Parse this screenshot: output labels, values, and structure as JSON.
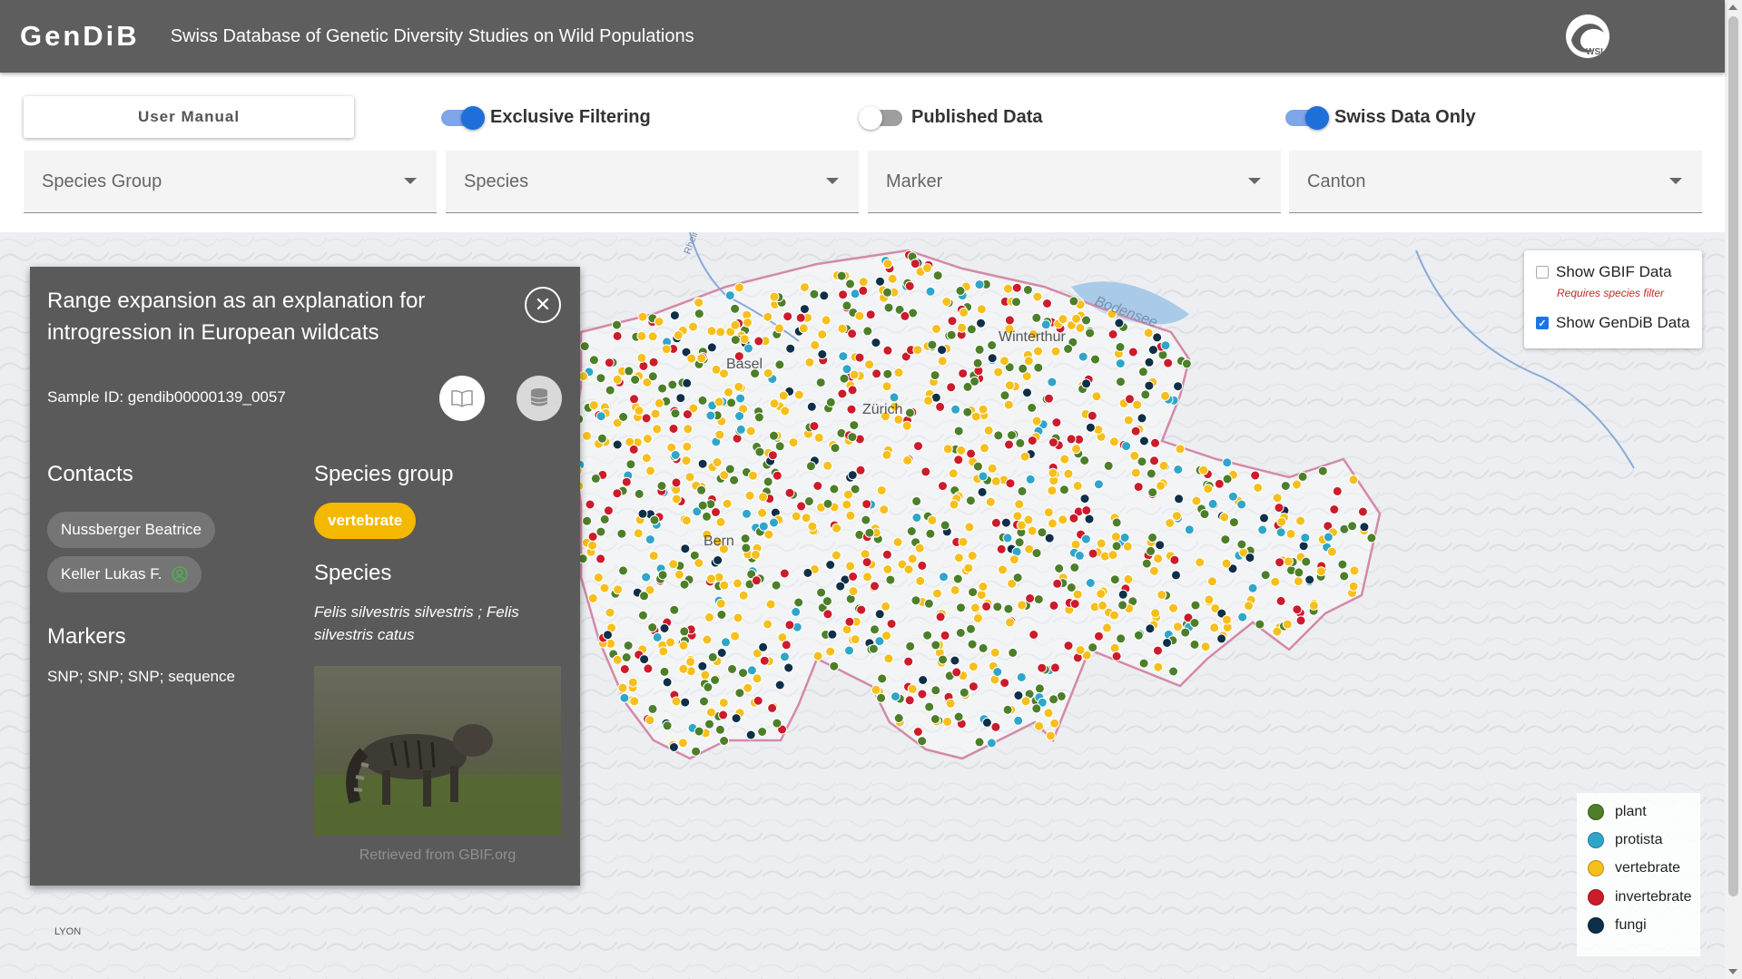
{
  "header": {
    "logo": "GenDiB",
    "title": "Swiss Database of Genetic Diversity Studies on Wild Populations",
    "org_logo_text": "WSL"
  },
  "controls": {
    "manual_label": "User Manual",
    "toggles": [
      {
        "label": "Exclusive Filtering",
        "on": true
      },
      {
        "label": "Published Data",
        "on": false
      },
      {
        "label": "Swiss Data Only",
        "on": true
      }
    ],
    "selects": [
      {
        "placeholder": "Species Group"
      },
      {
        "placeholder": "Species"
      },
      {
        "placeholder": "Marker"
      },
      {
        "placeholder": "Canton"
      }
    ]
  },
  "map": {
    "labels": [
      "Basel",
      "Zürich",
      "Bern",
      "Winterthur",
      "Bodensee",
      "LYON",
      "Rhein"
    ],
    "marker_colors": {
      "plant": "#4d7f2a",
      "protista": "#2fa6c9",
      "vertebrate": "#f6bf1c",
      "invertebrate": "#cc1b2b",
      "fungi": "#0e2f47"
    }
  },
  "popup": {
    "title": "Range expansion as an explanation for introgression in European wildcats",
    "sample_id": "Sample ID: gendib00000139_0057",
    "contacts_heading": "Contacts",
    "contacts": [
      "Nussberger Beatrice",
      "Keller Lukas F."
    ],
    "species_group_heading": "Species group",
    "species_group": "vertebrate",
    "species_heading": "Species",
    "species": "Felis silvestris silvestris ; Felis silvestris catus",
    "markers_heading": "Markers",
    "markers": "SNP; SNP; SNP; sequence",
    "image_credit": "Retrieved from GBIF.org"
  },
  "layers": {
    "gbif_label": "Show GBIF Data",
    "gbif_checked": false,
    "gbif_note": "Requires species filter",
    "gendib_label": "Show GenDiB Data",
    "gendib_checked": true
  },
  "legend": [
    {
      "label": "plant",
      "color": "#4d7f2a"
    },
    {
      "label": "protista",
      "color": "#2fa6c9"
    },
    {
      "label": "vertebrate",
      "color": "#f6bf1c"
    },
    {
      "label": "invertebrate",
      "color": "#cc1b2b"
    },
    {
      "label": "fungi",
      "color": "#0e2f47"
    }
  ]
}
